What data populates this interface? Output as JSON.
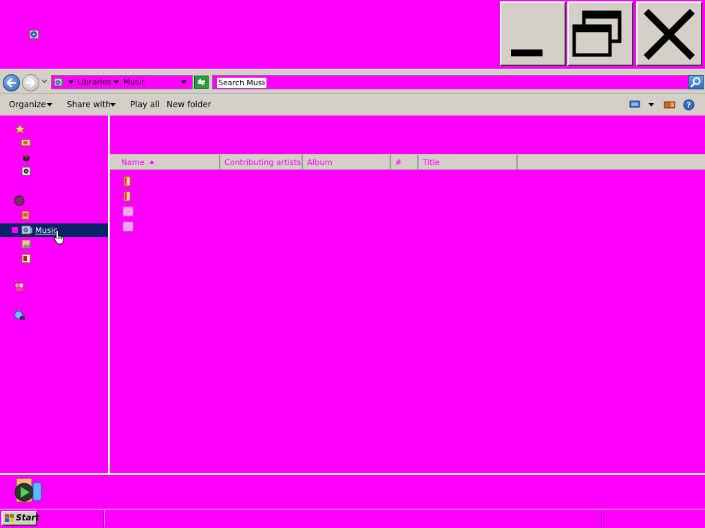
{
  "window": {
    "title_icon": "music-library-icon",
    "controls": {
      "minimize_icon": "minimize-icon",
      "maximize_icon": "restore-icon",
      "close_icon": "close-icon"
    }
  },
  "address": {
    "back_icon": "back-arrow-icon",
    "forward_icon": "forward-arrow-icon",
    "breadcrumb": [
      "Libraries",
      "Music"
    ],
    "search_value": "Search Music"
  },
  "toolbar": {
    "organize": "Organize",
    "share_with": "Share with",
    "play_all": "Play all",
    "new_folder": "New folder"
  },
  "nav": {
    "selected_item": "Music",
    "icons": [
      "favorites-icon",
      "desktop-icon",
      "downloads-icon",
      "recent-places-icon",
      "libraries-icon",
      "documents-icon",
      "music-icon",
      "pictures-icon",
      "videos-icon",
      "homegroup-icon",
      "computer-icon"
    ]
  },
  "columns": {
    "name": "Name",
    "contributing_artists": "Contributing artists",
    "album": "Album",
    "number": "#",
    "title": "Title"
  },
  "files": [
    {
      "icon": "folder-icon"
    },
    {
      "icon": "folder-icon"
    },
    {
      "icon": "playlist-icon"
    },
    {
      "icon": "playlist-icon"
    }
  ],
  "taskbar": {
    "start_label": "Start"
  },
  "colors": {
    "background": "#ff00ff",
    "chrome": "#d4d0c8",
    "selection": "#0a246a"
  }
}
